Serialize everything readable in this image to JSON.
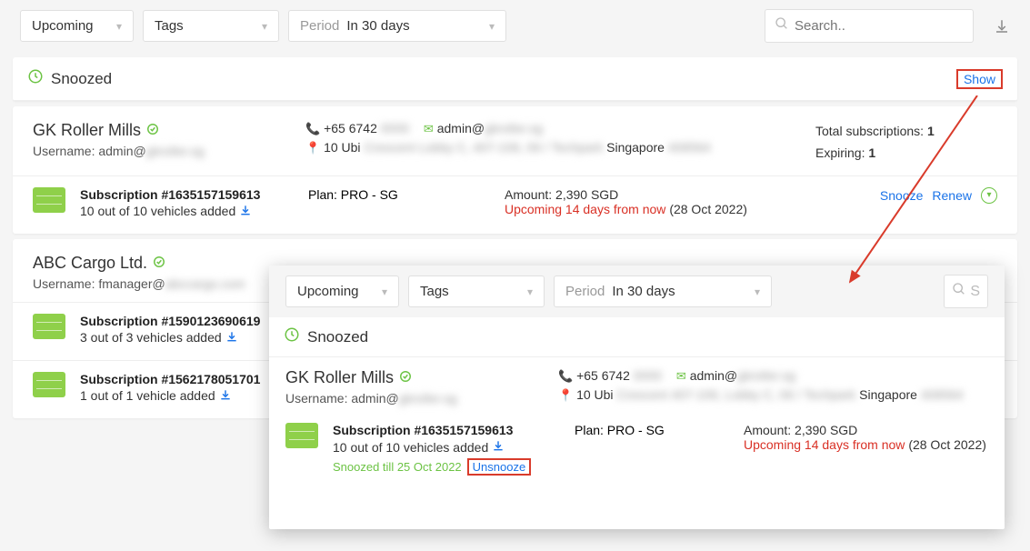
{
  "filters": {
    "upcoming": "Upcoming",
    "tags": "Tags",
    "period_label": "Period",
    "period_value": "In 30 days",
    "search_placeholder": "Search.."
  },
  "snoozed_section": {
    "title": "Snoozed",
    "show": "Show"
  },
  "company1": {
    "name": "GK Roller Mills",
    "username_label": "Username: admin@",
    "phone": "+65 6742",
    "email": "admin@",
    "address_prefix": "10 Ubi",
    "address_suffix": "Singapore",
    "total_label": "Total subscriptions:",
    "total_value": "1",
    "expiring_label": "Expiring:",
    "expiring_value": "1"
  },
  "sub1": {
    "title": "Subscription #1635157159613",
    "vehicles": "10 out of 10 vehicles added",
    "plan": "Plan: PRO - SG",
    "amount": "Amount: 2,390 SGD",
    "upcoming_prefix": "Upcoming",
    "upcoming_red": "14 days from now",
    "upcoming_date": "(28 Oct 2022)",
    "snooze": "Snooze",
    "renew": "Renew"
  },
  "company2": {
    "name": "ABC Cargo Ltd.",
    "username_label": "Username: fmanager@"
  },
  "sub2": {
    "title": "Subscription #1590123690619",
    "vehicles": "3 out of 3 vehicles added"
  },
  "sub3": {
    "title": "Subscription #1562178051701",
    "vehicles": "1 out of 1 vehicle added"
  },
  "panel2": {
    "snoozed_title": "Snoozed",
    "company_name": "GK Roller Mills",
    "username": "Username: admin@",
    "username_domain": "gkroller.sg",
    "phone": "+65 6742",
    "email": "admin@",
    "email_domain": "gkroller.sg",
    "address_prefix": "10 Ubi",
    "address_suffix": "Singapore",
    "sub_title": "Subscription #1635157159613",
    "vehicles": "10 out of 10 vehicles added",
    "snoozed_till": "Snoozed till 25 Oct 2022",
    "unsnooze": "Unsnooze",
    "plan": "Plan: PRO - SG",
    "amount": "Amount: 2,390 SGD",
    "upcoming_prefix": "Upcoming",
    "upcoming_red": "14 days from now",
    "upcoming_date": "(28 Oct 2022)"
  }
}
